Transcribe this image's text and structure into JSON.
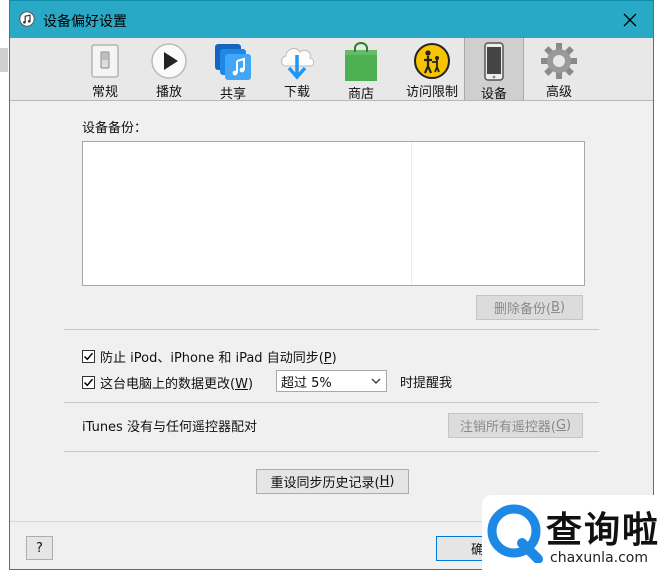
{
  "window": {
    "title": "设备偏好设置",
    "close_glyph": "✕"
  },
  "toolbar": {
    "items": [
      {
        "label": "常规"
      },
      {
        "label": "播放"
      },
      {
        "label": "共享"
      },
      {
        "label": "下载"
      },
      {
        "label": "商店"
      },
      {
        "label": "访问限制"
      },
      {
        "label": "设备",
        "active": true
      },
      {
        "label": "高级"
      }
    ]
  },
  "backups": {
    "label": "设备备份：",
    "delete_button": {
      "text": "删除备份(",
      "key": "B",
      "end": ")"
    }
  },
  "sync_options": {
    "prevent_sync": {
      "checked": true,
      "text": "防止 iPod、iPhone 和 iPad 自动同步(",
      "key": "P",
      "end": ")"
    },
    "data_change": {
      "checked": true,
      "text": "这台电脑上的数据更改(",
      "key": "W",
      "end": ")"
    },
    "threshold_select": {
      "value": "超过 5%"
    },
    "remind_text": "时提醒我"
  },
  "remote": {
    "status": "iTunes 没有与任何遥控器配对",
    "unregister_button": {
      "text": "注销所有遥控器(",
      "key": "G",
      "end": ")"
    }
  },
  "reset_history_button": {
    "text": "重设同步历史记录(",
    "key": "H",
    "end": ")"
  },
  "footer": {
    "help_label": "?",
    "ok_label": "确"
  },
  "watermark": {
    "brand": "查询啦",
    "domain": "chaxunla.com"
  },
  "colors": {
    "titlebar": "#2aa9c7",
    "window_bg": "#f0f0f0",
    "toolbar_bg": "#e8e8e8",
    "focus_border": "#0078d7",
    "watermark_blue": "#1e88e5"
  }
}
